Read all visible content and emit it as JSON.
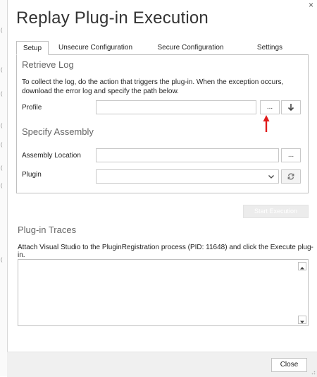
{
  "window": {
    "title": "Replay Plug-in Execution",
    "close_glyph": "×"
  },
  "background_glyphs": [
    "(",
    "(",
    "(",
    "(",
    "(",
    "(",
    "(",
    "("
  ],
  "tabs": [
    {
      "label": "Setup",
      "active": true
    },
    {
      "label": "Unsecure Configuration",
      "active": false
    },
    {
      "label": "Secure Configuration",
      "active": false
    },
    {
      "label": "Settings",
      "active": false
    }
  ],
  "retrieve_log": {
    "title": "Retrieve Log",
    "description": "To collect the log, do the action that triggers the plug-in. When the exception occurs, download the error log and specify the path below.",
    "profile_label": "Profile",
    "profile_value": "",
    "browse_label": "...",
    "download_icon": "download-arrow-icon"
  },
  "specify_assembly": {
    "title": "Specify Assembly",
    "assembly_label": "Assembly Location",
    "assembly_value": "",
    "browse_label": "...",
    "plugin_label": "Plugin",
    "plugin_value": "",
    "refresh_icon": "refresh-icon"
  },
  "start_execution_label": "Start Execution",
  "plugin_traces": {
    "title": "Plug-in Traces",
    "description": "Attach Visual Studio to the PluginRegistration process (PID: 11648) and click the Execute plug-in.",
    "content": ""
  },
  "footer": {
    "close_label": "Close"
  },
  "colors": {
    "annotation_arrow": "#e01b1b",
    "disabled_button_bg": "#ececec",
    "footer_bg": "#f0f0f0"
  }
}
